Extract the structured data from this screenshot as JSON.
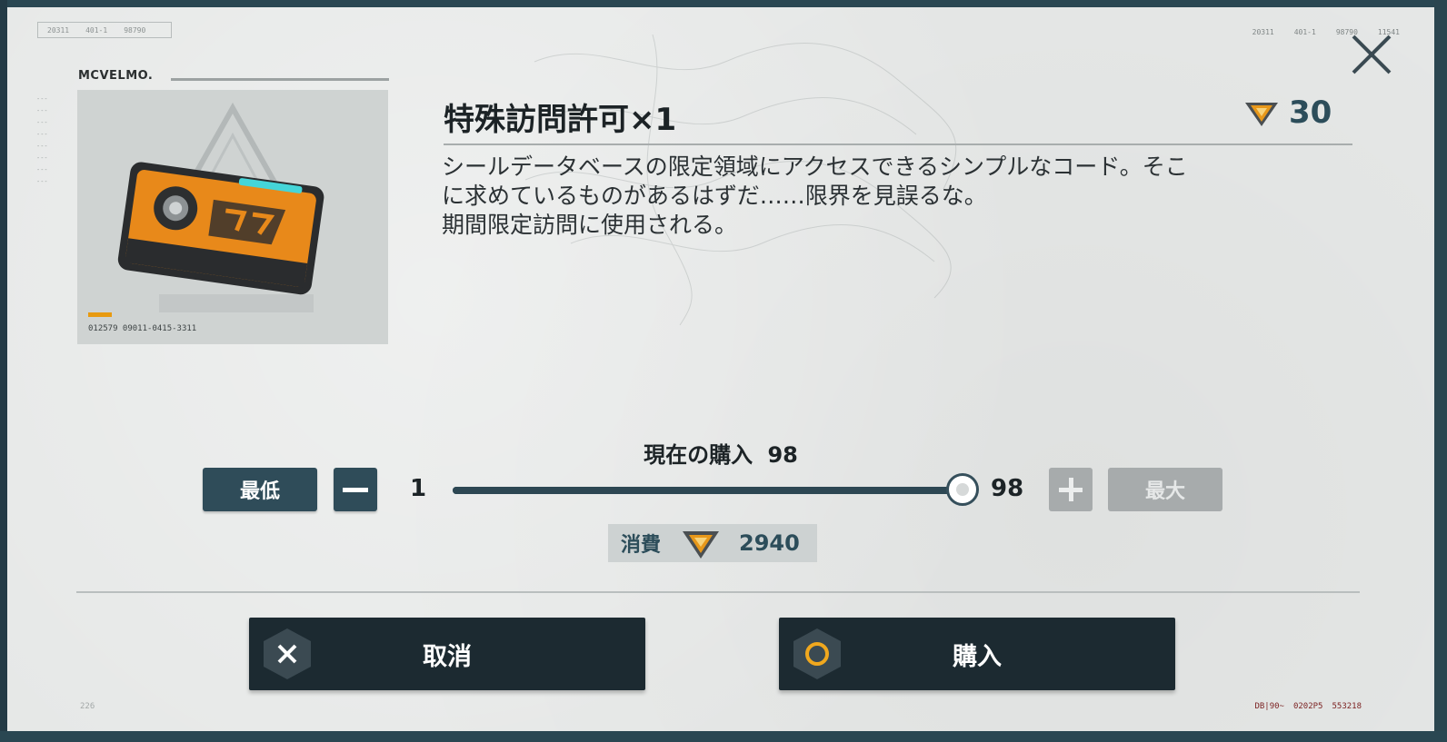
{
  "brand": "MCVELMO.",
  "codes": {
    "top_left": [
      "20311",
      "401-1",
      "98790"
    ],
    "top_right": [
      "20311",
      "401-1",
      "98790",
      "11541"
    ],
    "bottom_left": "226",
    "bottom_right": [
      "DB|90~",
      "0202P5",
      "553218"
    ]
  },
  "item": {
    "title": "特殊訪問許可×1",
    "price": "30",
    "image_code": "012579  09011-0415-3311",
    "description": [
      "シールデータベースの限定領域にアクセスできるシンプルなコード。そこ",
      "に求めているものがあるはずだ……限界を見誤るな。",
      "期間限定訪問に使用される。"
    ]
  },
  "purchase": {
    "current_label": "現在の購入",
    "current_value": "98",
    "min_button": "最低",
    "max_button": "最大",
    "slider_min": "1",
    "slider_max": "98",
    "slider_value": 98,
    "cost_label": "消費",
    "cost_value": "2940"
  },
  "actions": {
    "cancel": "取消",
    "buy": "購入"
  },
  "colors": {
    "accent": "#2f4c59",
    "currency_orange": "#e8981a",
    "buy_ring": "#f0a81e",
    "disabled": "#a7abac"
  }
}
